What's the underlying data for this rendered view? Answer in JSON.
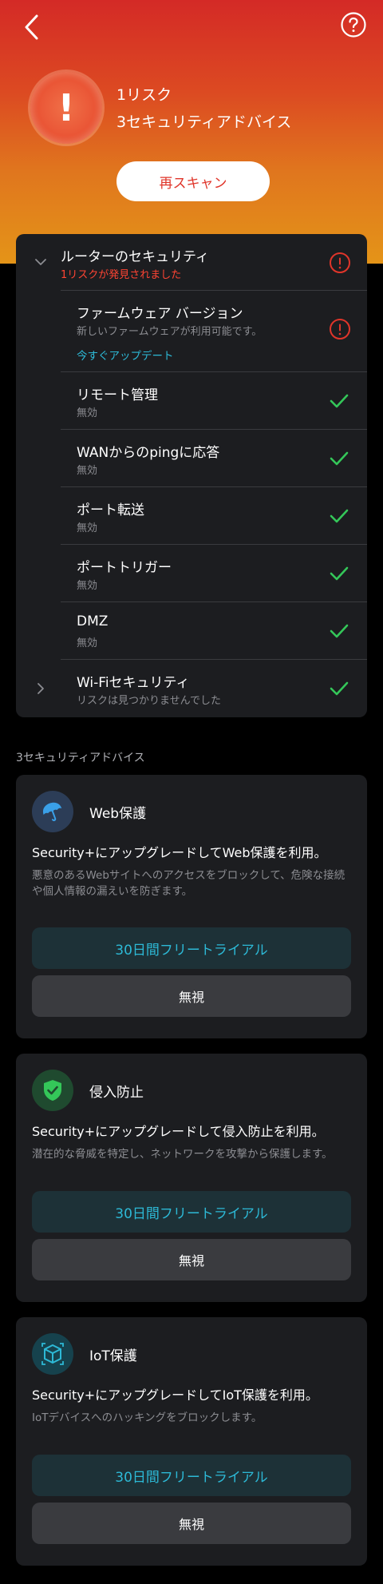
{
  "colors": {
    "accent_red": "#e0352a",
    "accent_teal": "#2db9d6",
    "ok_green": "#34c759",
    "card_bg": "#1c1d20"
  },
  "hero": {
    "risk_count": "1リスク",
    "advice_count": "3セキュリティアドバイス",
    "rescan_label": "再スキャン",
    "badge_symbol": "!"
  },
  "router": {
    "header_title": "ルーターのセキュリティ",
    "header_sub": "1リスクが発見されました",
    "items": [
      {
        "title": "ファームウェア バージョン",
        "sub": "新しいファームウェアが利用可能です。",
        "action": "今すぐアップデート",
        "status": "warning"
      },
      {
        "title": "リモート管理",
        "sub": "無効",
        "status": "ok"
      },
      {
        "title": "WANからのpingに応答",
        "sub": "無効",
        "status": "ok"
      },
      {
        "title": "ポート転送",
        "sub": "無効",
        "status": "ok"
      },
      {
        "title": "ポートトリガー",
        "sub": "無効",
        "status": "ok"
      },
      {
        "title": "DMZ",
        "sub": "無効",
        "status": "ok"
      }
    ],
    "wifi": {
      "title": "Wi-Fiセキュリティ",
      "sub": "リスクは見つかりませんでした",
      "status": "ok"
    }
  },
  "advice_section_title": "3セキュリティアドバイス",
  "advice": [
    {
      "name": "Web保護",
      "icon": "umbrella-icon",
      "headline": "Security+にアップグレードしてWeb保護を利用。",
      "desc": "悪意のあるWebサイトへのアクセスをブロックして、危険な接続や個人情報の漏えいを防ぎます。",
      "trial_label": "30日間フリートライアル",
      "ignore_label": "無視"
    },
    {
      "name": "侵入防止",
      "icon": "shield-check-icon",
      "headline": "Security+にアップグレードして侵入防止を利用。",
      "desc": "潜在的な脅威を特定し、ネットワークを攻撃から保護します。",
      "trial_label": "30日間フリートライアル",
      "ignore_label": "無視"
    },
    {
      "name": "IoT保護",
      "icon": "iot-cube-icon",
      "headline": "Security+にアップグレードしてIoT保護を利用。",
      "desc": "IoTデバイスへのハッキングをブロックします。",
      "trial_label": "30日間フリートライアル",
      "ignore_label": "無視"
    }
  ]
}
